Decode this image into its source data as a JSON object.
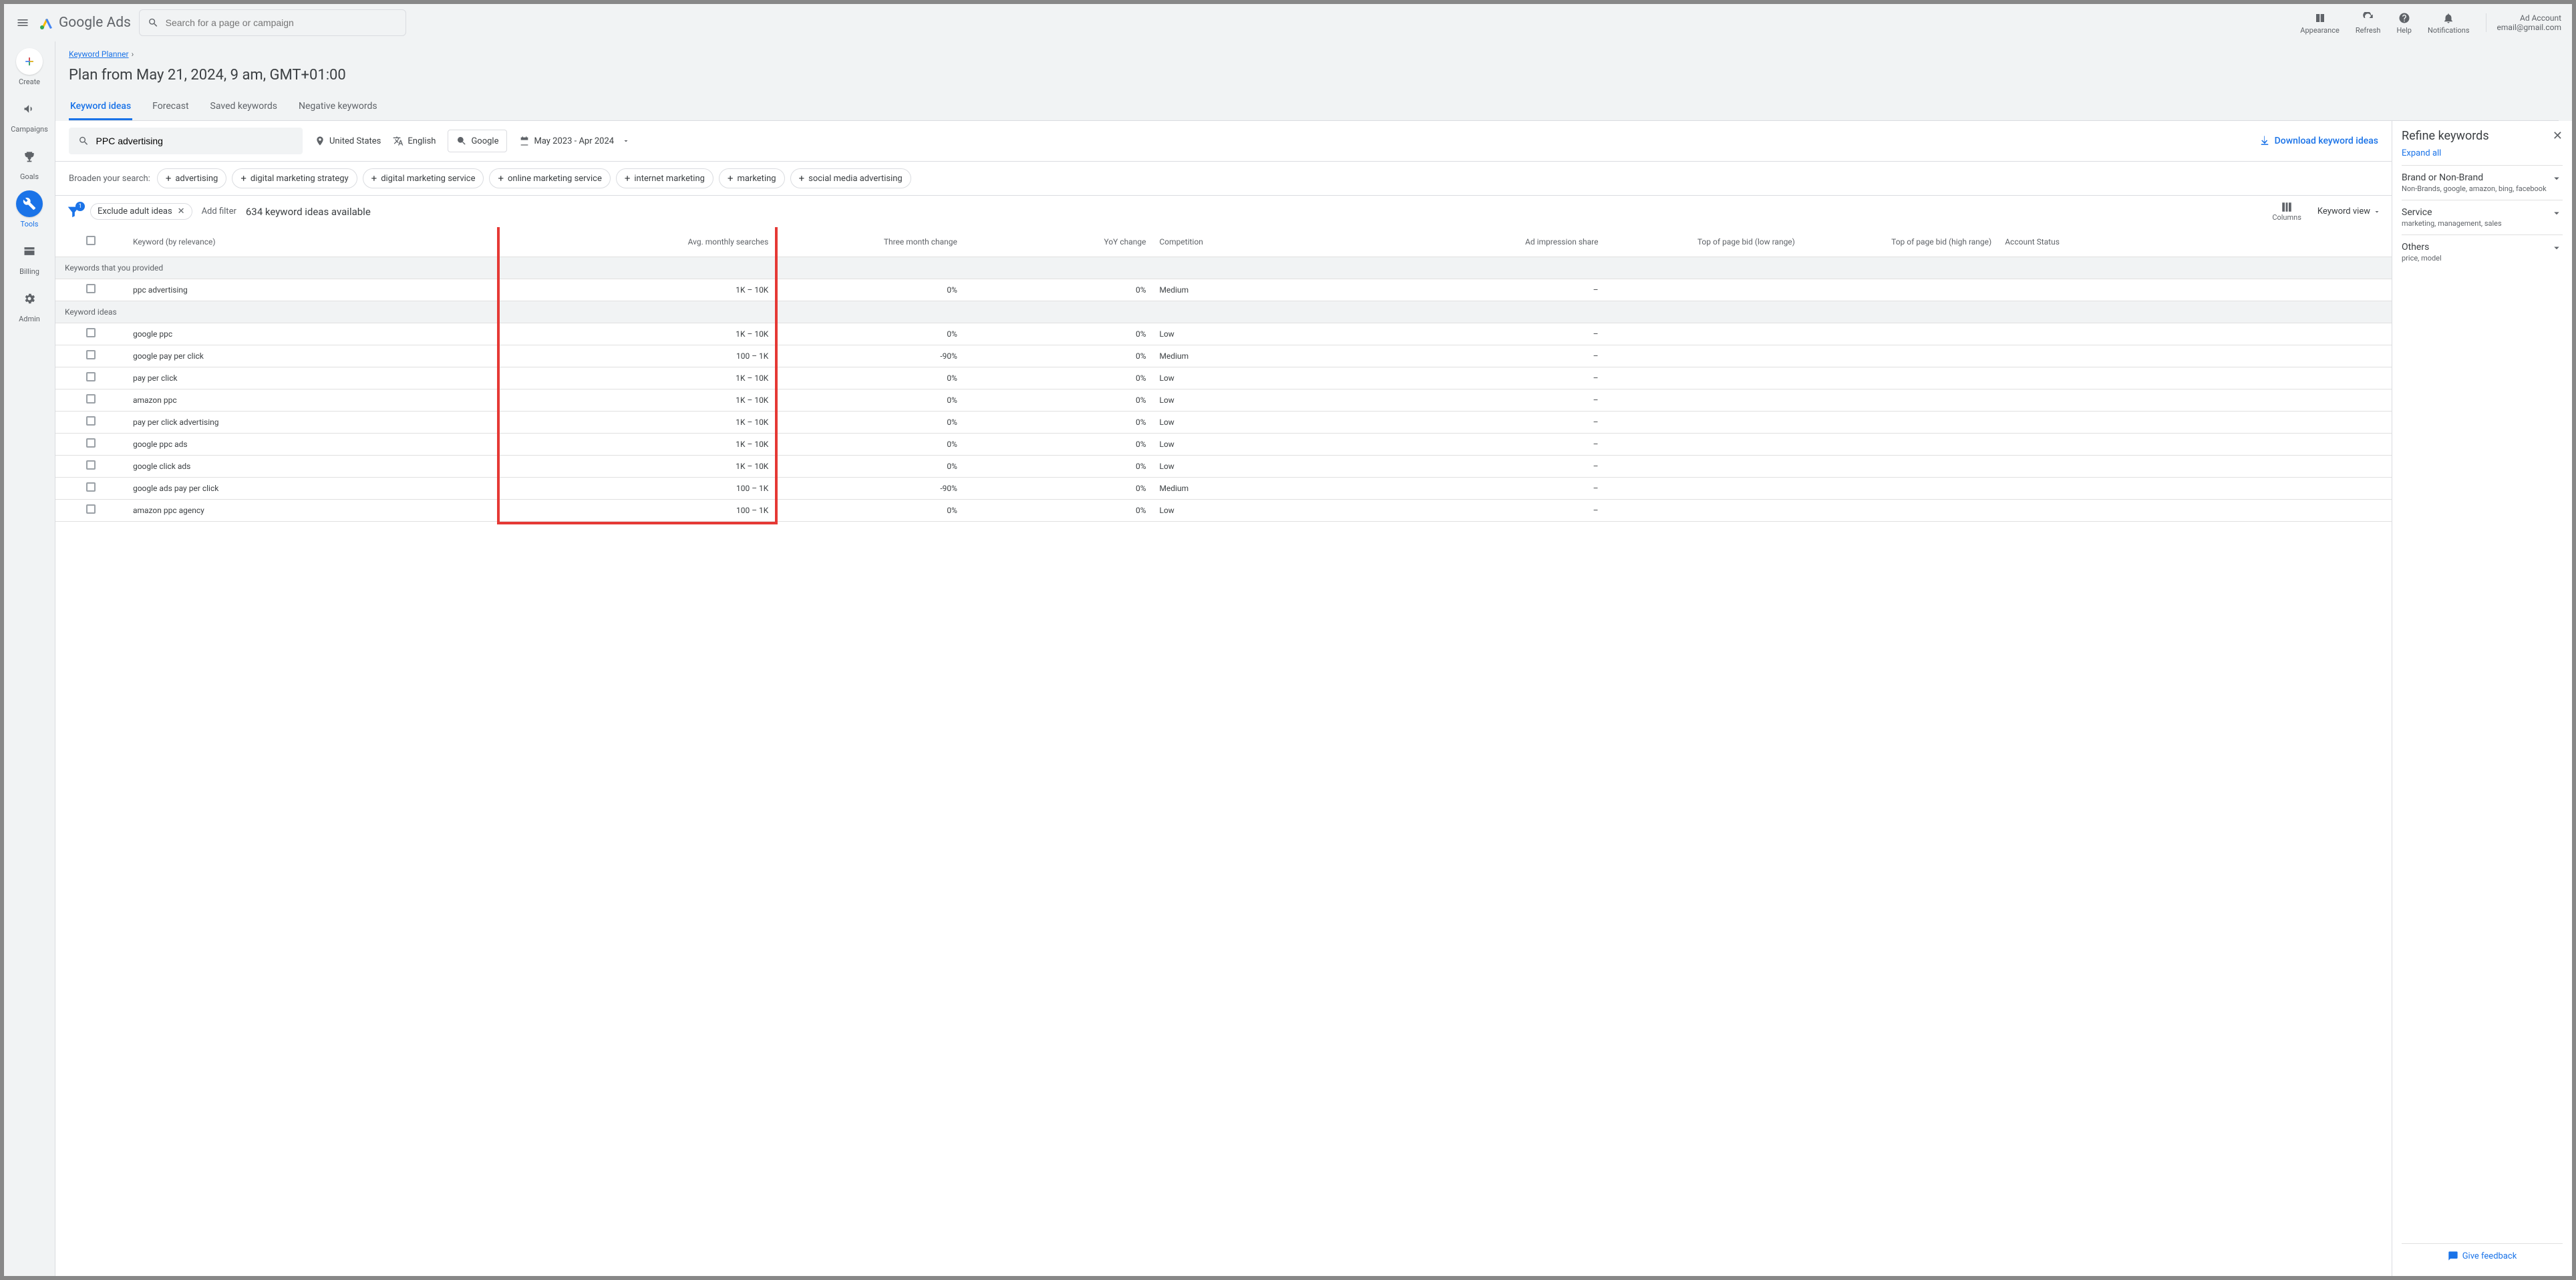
{
  "topbar": {
    "search_placeholder": "Search for a page or campaign",
    "logo_text": "Google Ads",
    "actions": {
      "appearance": "Appearance",
      "refresh": "Refresh",
      "help": "Help",
      "notifications": "Notifications"
    },
    "account": {
      "line1": "Ad Account",
      "line2": "email@gmail.com"
    }
  },
  "leftnav": {
    "create": "Create",
    "campaigns": "Campaigns",
    "goals": "Goals",
    "tools": "Tools",
    "billing": "Billing",
    "admin": "Admin"
  },
  "breadcrumb": {
    "parent": "Keyword Planner"
  },
  "page_title": "Plan from May 21, 2024, 9 am, GMT+01:00",
  "tabs": {
    "ideas": "Keyword ideas",
    "forecast": "Forecast",
    "saved": "Saved keywords",
    "negative": "Negative keywords"
  },
  "filters": {
    "keyword": "PPC advertising",
    "location": "United States",
    "language": "English",
    "network": "Google",
    "daterange": "May 2023 - Apr 2024",
    "download": "Download keyword ideas"
  },
  "broaden": {
    "label": "Broaden your search:",
    "chips": [
      "advertising",
      "digital marketing strategy",
      "digital marketing service",
      "online marketing service",
      "internet marketing",
      "marketing",
      "social media advertising"
    ]
  },
  "controls": {
    "exclude_chip": "Exclude adult ideas",
    "add_filter": "Add filter",
    "count_text": "634 keyword ideas available",
    "columns": "Columns",
    "view": "Keyword view"
  },
  "columns": {
    "keyword": "Keyword (by relevance)",
    "avg": "Avg. monthly searches",
    "three_month": "Three month change",
    "yoy": "YoY change",
    "competition": "Competition",
    "impression": "Ad impression share",
    "bid_low": "Top of page bid (low range)",
    "bid_high": "Top of page bid (high range)",
    "account": "Account Status"
  },
  "sections": {
    "provided": "Keywords that you provided",
    "ideas": "Keyword ideas"
  },
  "rows_provided": [
    {
      "kw": "ppc advertising",
      "avg": "1K – 10K",
      "tm": "0%",
      "yoy": "0%",
      "comp": "Medium",
      "imp": "–"
    }
  ],
  "rows_ideas": [
    {
      "kw": "google ppc",
      "avg": "1K – 10K",
      "tm": "0%",
      "yoy": "0%",
      "comp": "Low",
      "imp": "–"
    },
    {
      "kw": "google pay per click",
      "avg": "100 – 1K",
      "tm": "-90%",
      "yoy": "0%",
      "comp": "Medium",
      "imp": "–"
    },
    {
      "kw": "pay per click",
      "avg": "1K – 10K",
      "tm": "0%",
      "yoy": "0%",
      "comp": "Low",
      "imp": "–"
    },
    {
      "kw": "amazon ppc",
      "avg": "1K – 10K",
      "tm": "0%",
      "yoy": "0%",
      "comp": "Low",
      "imp": "–"
    },
    {
      "kw": "pay per click advertising",
      "avg": "1K – 10K",
      "tm": "0%",
      "yoy": "0%",
      "comp": "Low",
      "imp": "–"
    },
    {
      "kw": "google ppc ads",
      "avg": "1K – 10K",
      "tm": "0%",
      "yoy": "0%",
      "comp": "Low",
      "imp": "–"
    },
    {
      "kw": "google click ads",
      "avg": "1K – 10K",
      "tm": "0%",
      "yoy": "0%",
      "comp": "Low",
      "imp": "–"
    },
    {
      "kw": "google ads pay per click",
      "avg": "100 – 1K",
      "tm": "-90%",
      "yoy": "0%",
      "comp": "Medium",
      "imp": "–"
    },
    {
      "kw": "amazon ppc agency",
      "avg": "100 – 1K",
      "tm": "0%",
      "yoy": "0%",
      "comp": "Low",
      "imp": "–"
    }
  ],
  "refine": {
    "title": "Refine keywords",
    "expand": "Expand all",
    "groups": [
      {
        "title": "Brand or Non-Brand",
        "sub": "Non-Brands, google, amazon, bing, facebook"
      },
      {
        "title": "Service",
        "sub": "marketing, management, sales"
      },
      {
        "title": "Others",
        "sub": "price, model"
      }
    ],
    "feedback": "Give feedback"
  }
}
